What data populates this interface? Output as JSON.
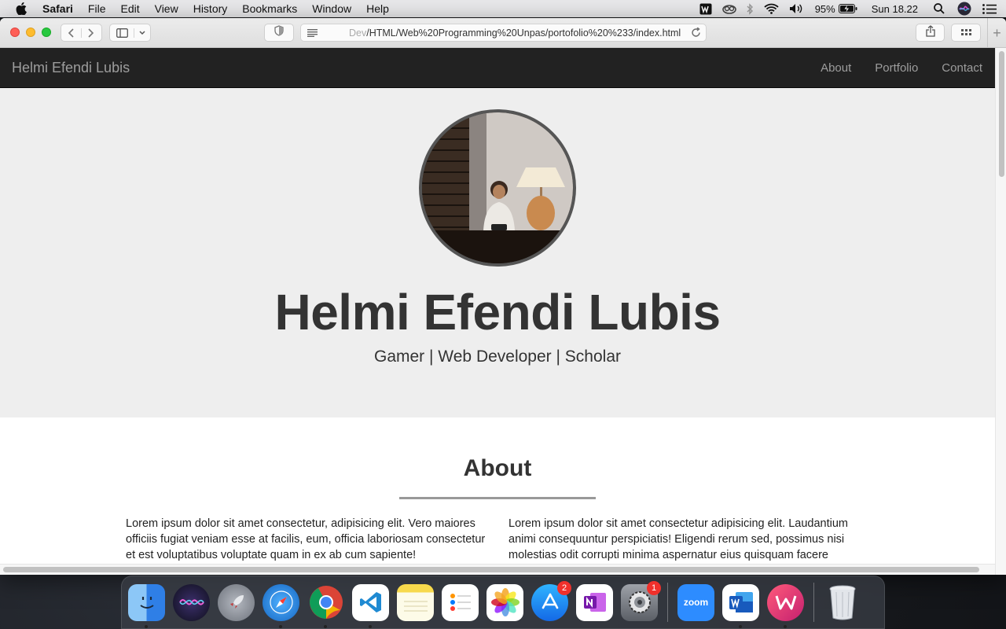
{
  "menubar": {
    "app_name": "Safari",
    "items": [
      "File",
      "Edit",
      "View",
      "History",
      "Bookmarks",
      "Window",
      "Help"
    ],
    "battery": "95%",
    "clock": "Sun 18.22"
  },
  "browser": {
    "url_faded": "Dev",
    "url": "/HTML/Web%20Programming%20Unpas/portofolio%20%233/index.html"
  },
  "site": {
    "brand": "Helmi Efendi Lubis",
    "nav": [
      "About",
      "Portfolio",
      "Contact"
    ],
    "hero": {
      "name": "Helmi Efendi Lubis",
      "tagline": "Gamer | Web Developer | Scholar"
    },
    "about": {
      "title": "About",
      "left": "Lorem ipsum dolor sit amet consectetur, adipisicing elit. Vero maiores officiis fugiat veniam esse at facilis, eum, officia laboriosam consectetur et est voluptatibus voluptate quam in ex ab cum sapiente!",
      "right": "Lorem ipsum dolor sit amet consectetur adipisicing elit. Laudantium animi consequuntur perspiciatis! Eligendi rerum sed, possimus nisi molestias odit corrupti minima aspernatur eius quisquam facere"
    }
  },
  "dock": {
    "apps": [
      {
        "name": "finder-icon",
        "color": "#3b8ff0"
      },
      {
        "name": "siri-icon",
        "color": "#1a1a2e"
      },
      {
        "name": "launchpad-icon",
        "color": "#8a8f99"
      },
      {
        "name": "safari-icon",
        "color": "#1e88e5"
      },
      {
        "name": "chrome-icon",
        "color": "#ffffff"
      },
      {
        "name": "vscode-icon",
        "color": "#ffffff"
      },
      {
        "name": "notes-icon",
        "color": "#f8e27a"
      },
      {
        "name": "reminders-icon",
        "color": "#ffffff"
      },
      {
        "name": "photos-icon",
        "color": "#ffffff"
      },
      {
        "name": "app-store-icon",
        "color": "#1f8cf5",
        "badge": "2"
      },
      {
        "name": "onenote-icon",
        "color": "#ffffff"
      },
      {
        "name": "system-preferences-icon",
        "color": "#7b7f86",
        "badge": "1"
      },
      {
        "name": "zoom-icon",
        "color": "#2d8cff",
        "label": "zoom"
      },
      {
        "name": "word-icon",
        "color": "#ffffff"
      },
      {
        "name": "wps-icon",
        "color": "#e52f76"
      },
      {
        "name": "trash-icon",
        "color": "#c9cbd0"
      }
    ]
  }
}
